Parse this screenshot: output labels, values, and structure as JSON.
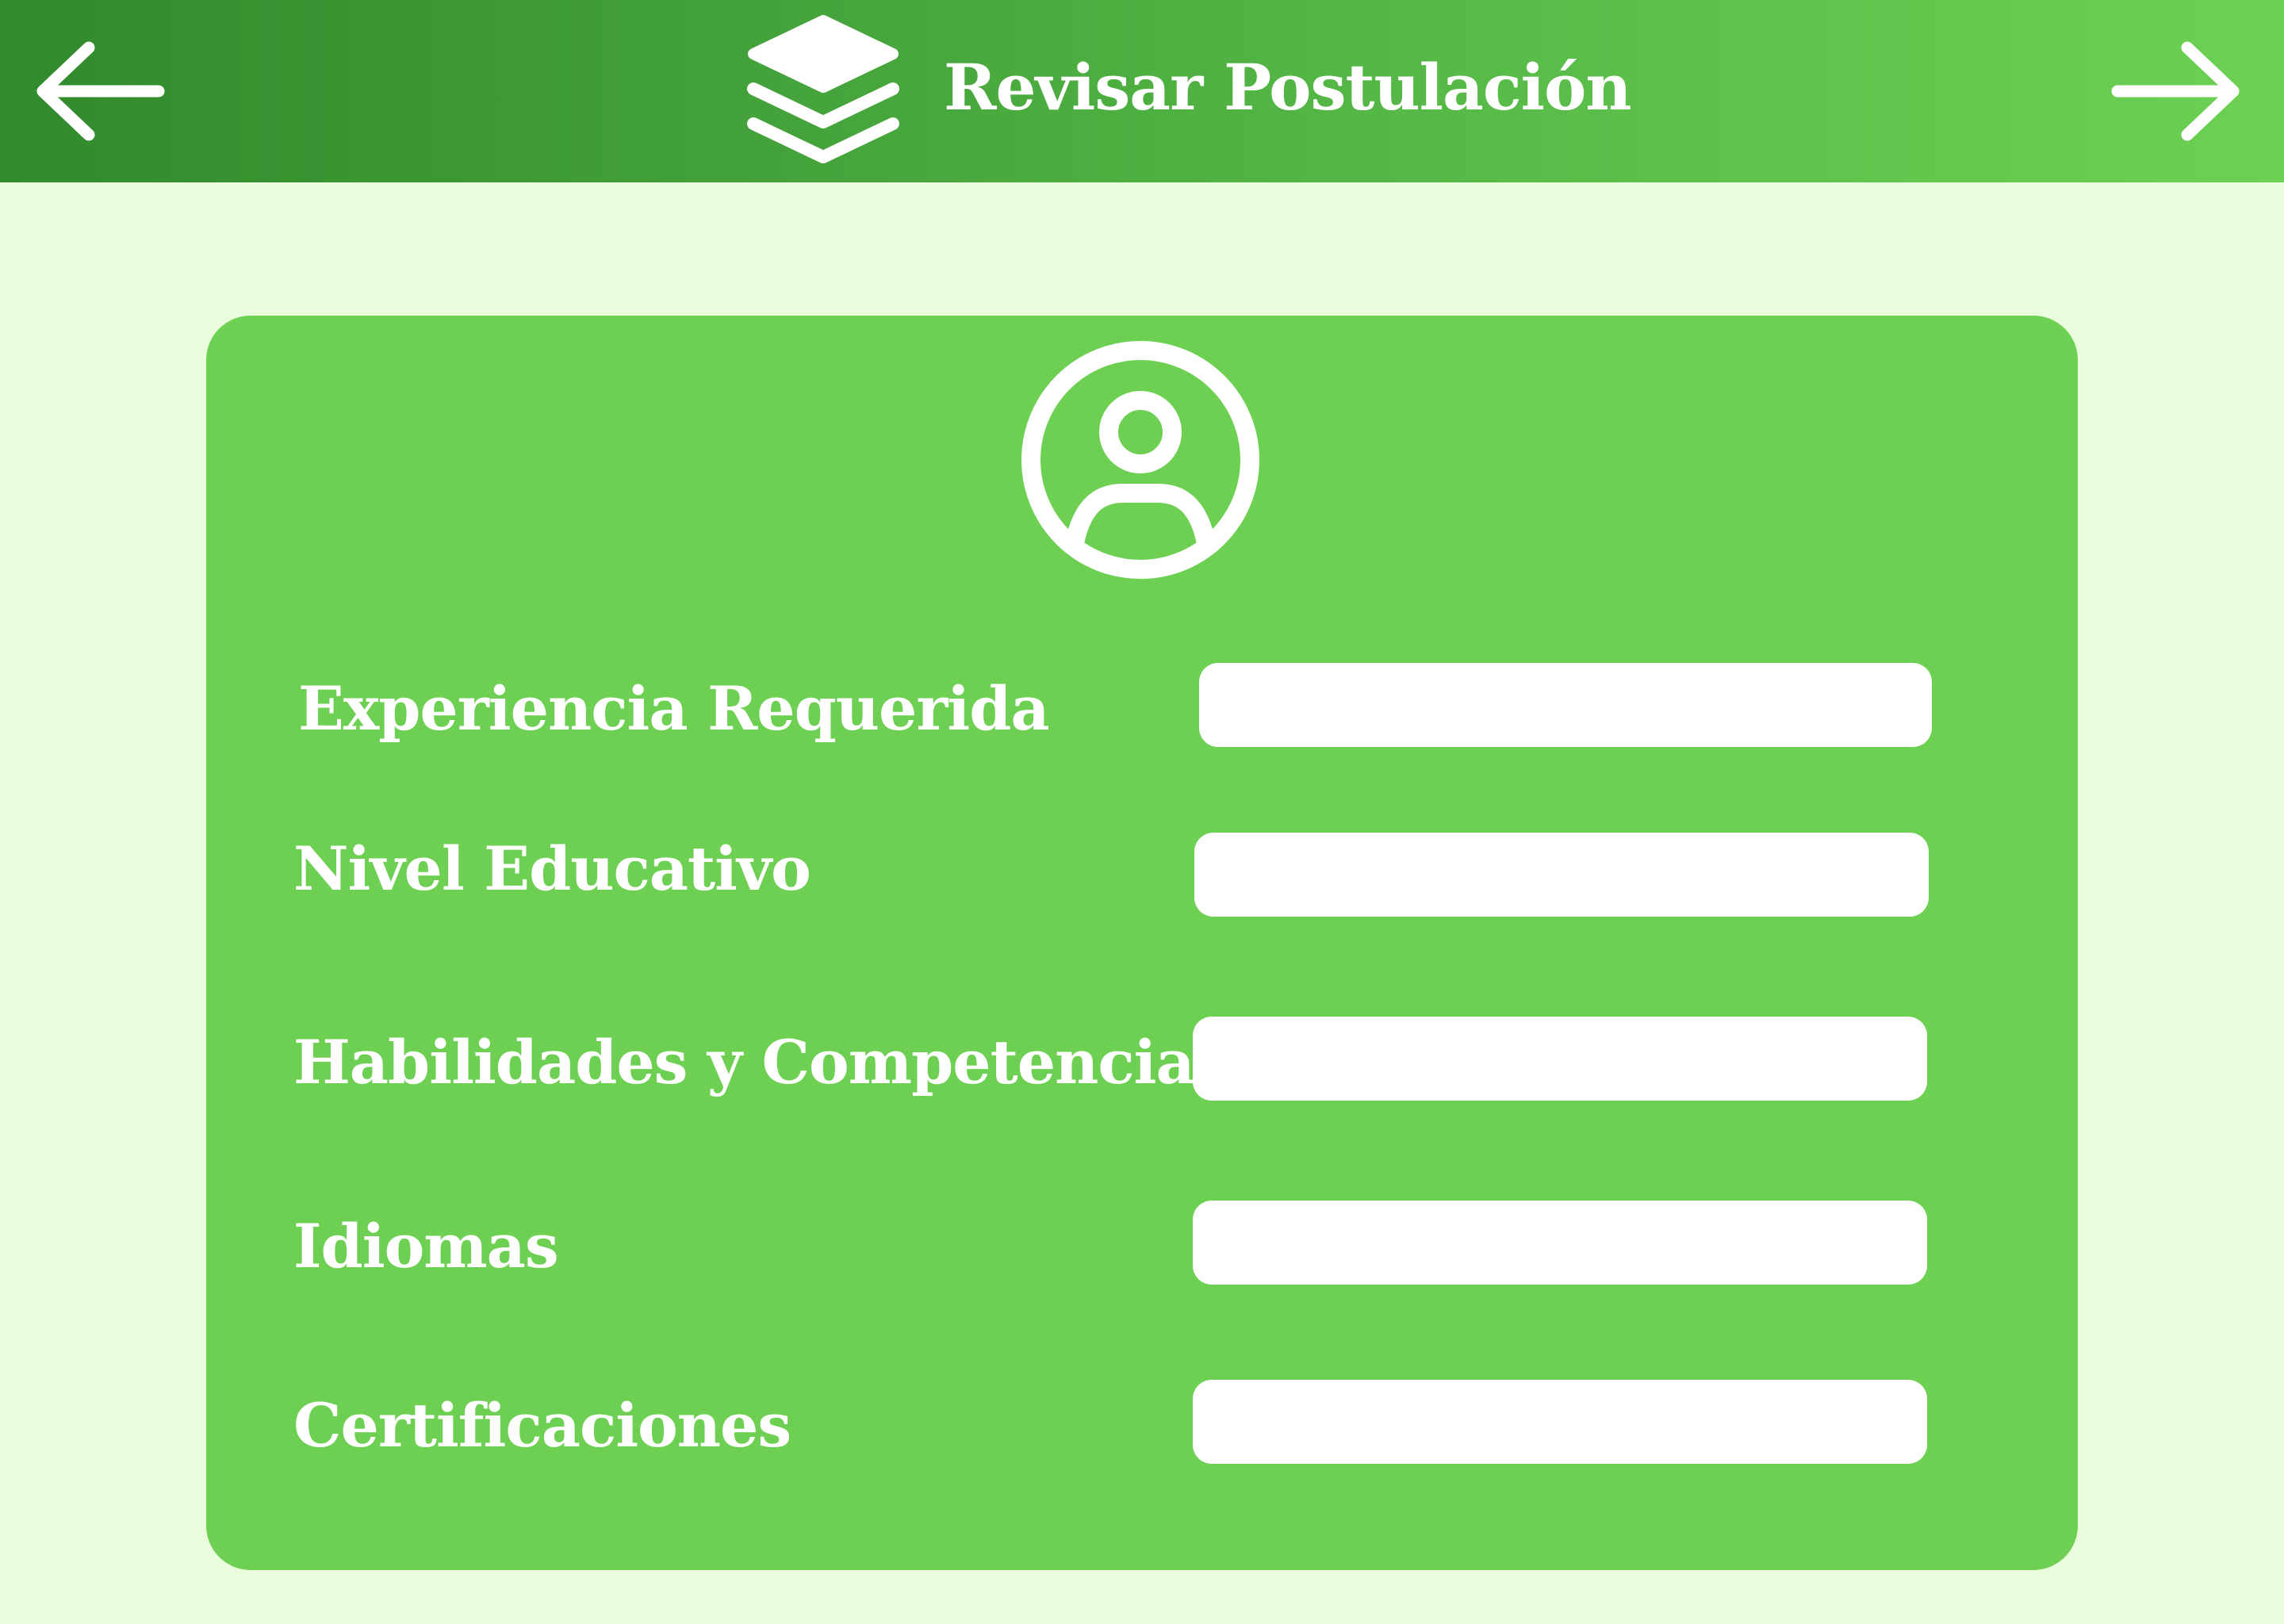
{
  "header": {
    "title": "Revisar Postulación",
    "back_icon": "arrow-left-icon",
    "forward_icon": "arrow-right-icon",
    "logo_icon": "layers-icon"
  },
  "card": {
    "avatar_icon": "user-circle-icon",
    "fields": [
      {
        "label": "Experiencia Requerida",
        "value": "",
        "placeholder": ""
      },
      {
        "label": "Nivel Educativo",
        "value": "",
        "placeholder": ""
      },
      {
        "label": "Habilidades y Competencias",
        "value": "",
        "placeholder": ""
      },
      {
        "label": "Idiomas",
        "value": "",
        "placeholder": ""
      },
      {
        "label": "Certificaciones",
        "value": "",
        "placeholder": ""
      }
    ]
  },
  "colors": {
    "header_gradient_start": "#318A2C",
    "header_gradient_end": "#6CD153",
    "page_background": "#EAFDDC",
    "card_background": "#6DD053",
    "text": "#FFFFFF",
    "input_background": "#FFFFFF"
  }
}
